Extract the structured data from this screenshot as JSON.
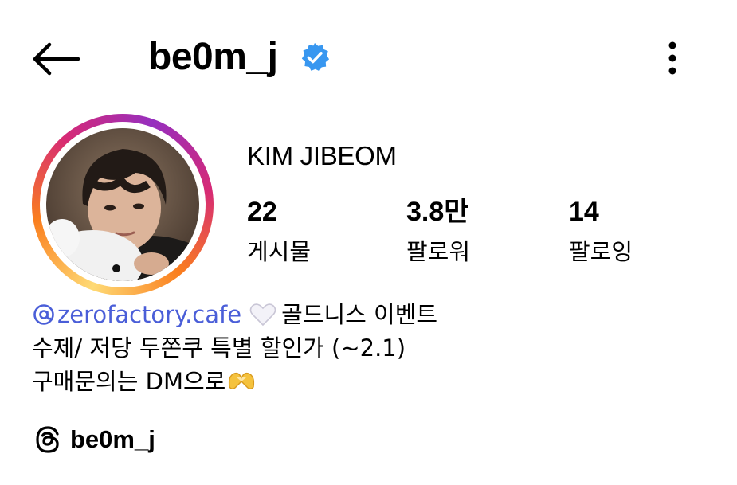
{
  "header": {
    "back_icon": "arrow-left-icon",
    "username": "be0m_j",
    "verified_icon": "verified-badge-icon",
    "verified_color": "#3897f0",
    "more_icon": "vertical-ellipsis-icon"
  },
  "profile": {
    "avatar_ring_colors": [
      "#feda75",
      "#fa7e1e",
      "#d62976",
      "#962fbf"
    ],
    "display_name": "KIM JIBEOM",
    "stats": [
      {
        "value": "22",
        "label": "게시물"
      },
      {
        "value": "3.8만",
        "label": "팔로워"
      },
      {
        "value": "14",
        "label": "팔로잉"
      }
    ]
  },
  "bio": {
    "mention_icon": "threads-at-icon",
    "mention": "zerofactory.cafe",
    "mention_color": "#4a5ed8",
    "line1_emoji": "white-heart-icon",
    "line1_text": "골드니스 이벤트",
    "line2": "수제/ 저당 두쫀쿠 특별 할인가 (~2.1)",
    "line3_text": "구매문의는 DM으로",
    "line3_emoji": "heart-hands-icon"
  },
  "threads_link": {
    "icon": "threads-logo-icon",
    "handle": "be0m_j"
  }
}
